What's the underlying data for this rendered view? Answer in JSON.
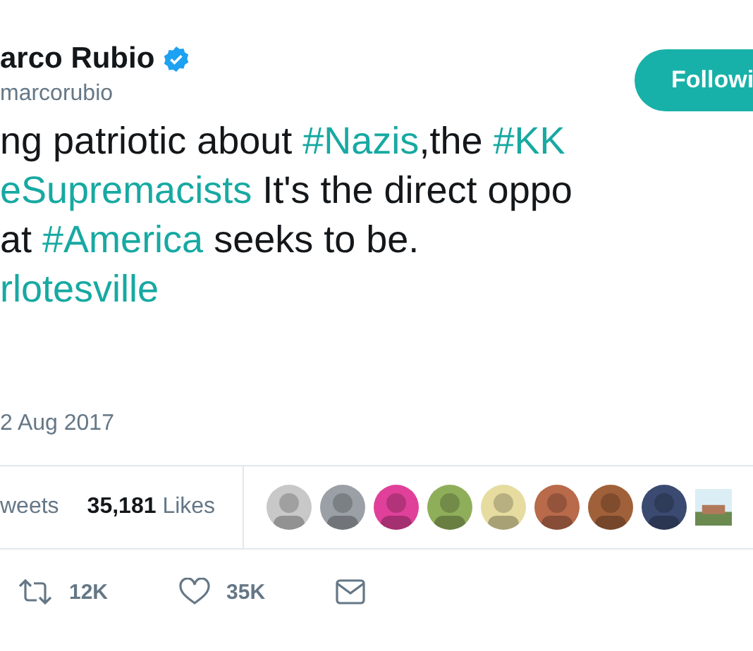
{
  "author": {
    "name": "arco Rubio",
    "verified": true,
    "handle": "marcorubio"
  },
  "follow_button": {
    "label": "Followi"
  },
  "tweet_lines": [
    [
      {
        "kind": "text",
        "text": "ng patriotic about "
      },
      {
        "kind": "hashtag",
        "text": "#Nazis"
      },
      {
        "kind": "text",
        "text": ",the "
      },
      {
        "kind": "hashtag",
        "text": "#KK"
      }
    ],
    [
      {
        "kind": "hashtag",
        "text": "eSupremacists"
      },
      {
        "kind": "text",
        "text": " It's the direct oppo"
      }
    ],
    [
      {
        "kind": "text",
        "text": "at "
      },
      {
        "kind": "hashtag",
        "text": "#America"
      },
      {
        "kind": "text",
        "text": " seeks to be."
      }
    ],
    [
      {
        "kind": "hashtag",
        "text": "rlotesville"
      }
    ]
  ],
  "date": "2 Aug 2017",
  "stats": [
    {
      "label": "weets"
    },
    {
      "count": "35,181",
      "label": "Likes"
    }
  ],
  "liker_avatars": [
    {
      "kind": "picture"
    },
    {
      "kind": "picture"
    },
    {
      "kind": "picture"
    },
    {
      "kind": "picture"
    },
    {
      "kind": "picture"
    },
    {
      "kind": "picture"
    },
    {
      "kind": "picture"
    },
    {
      "kind": "picture"
    },
    {
      "kind": "picture"
    }
  ],
  "actions": [
    {
      "kind": "retweet",
      "count": "12K"
    },
    {
      "kind": "like",
      "count": "35K"
    },
    {
      "kind": "message"
    }
  ]
}
